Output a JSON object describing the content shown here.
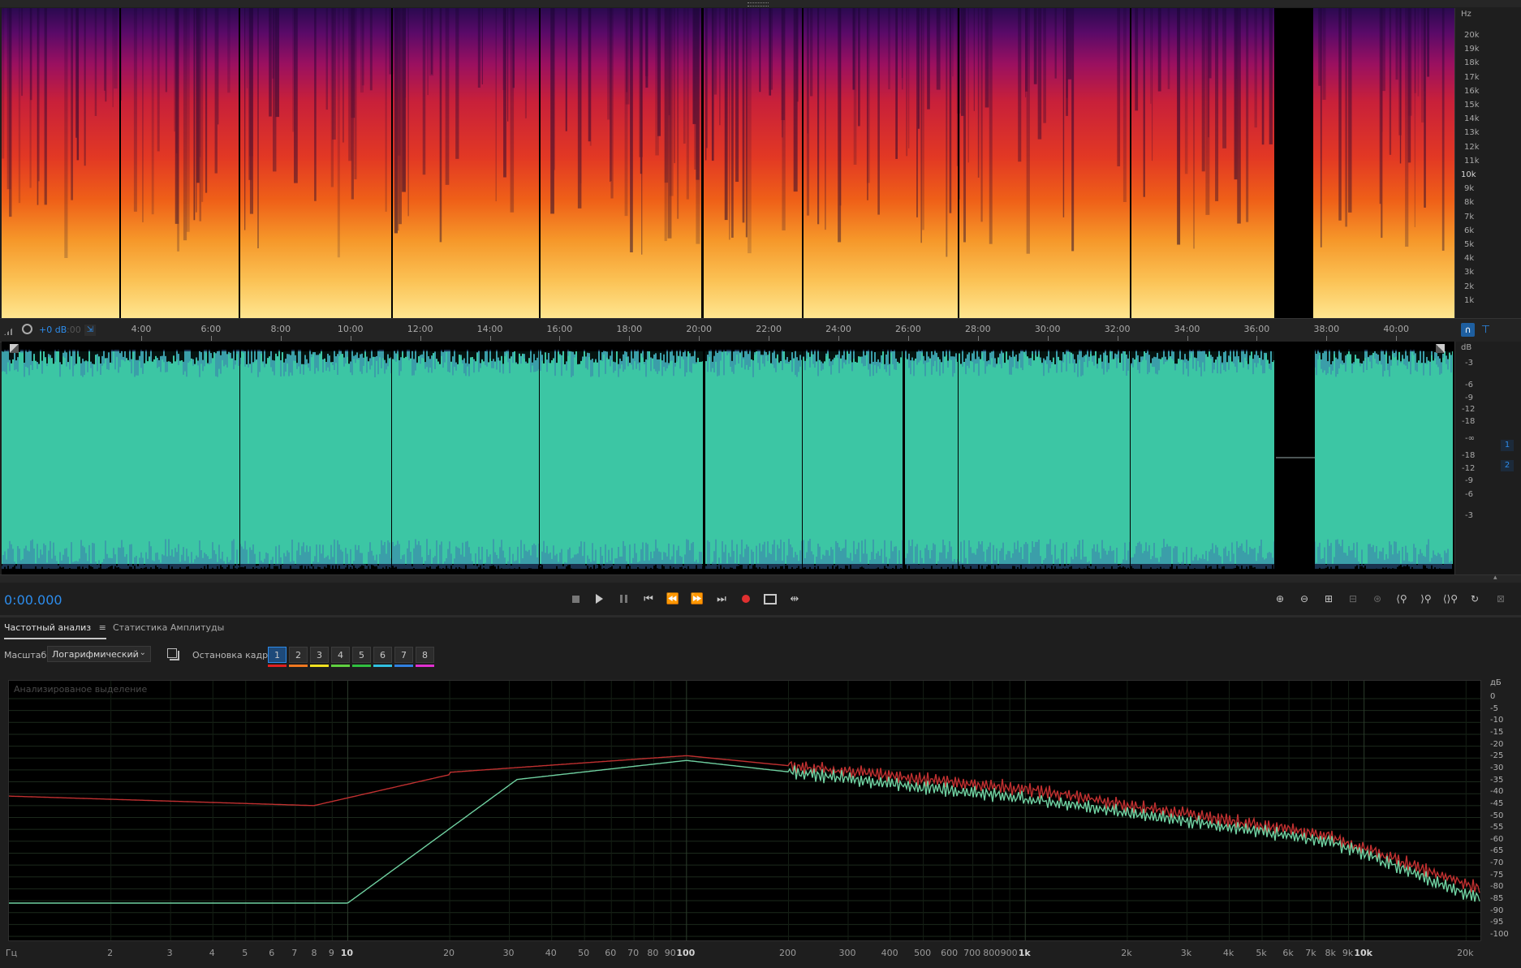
{
  "spectral_axis": {
    "unit": "Hz",
    "labels": [
      "20k",
      "19k",
      "18k",
      "17k",
      "16k",
      "15k",
      "14k",
      "13k",
      "12k",
      "11k",
      "10k",
      "9k",
      "8k",
      "7k",
      "6k",
      "5k",
      "4k",
      "3k",
      "2k",
      "1k"
    ]
  },
  "timeline": {
    "ticks": [
      "4:00",
      "6:00",
      "8:00",
      "10:00",
      "12:00",
      "14:00",
      "16:00",
      "18:00",
      "20:00",
      "22:00",
      "24:00",
      "26:00",
      "28:00",
      "30:00",
      "32:00",
      "34:00",
      "36:00",
      "38:00",
      "40:00"
    ],
    "gain_label": "+0 dB",
    "ghost_label": ":00"
  },
  "amplitude_axis": {
    "unit": "dB",
    "labels": [
      "-3",
      "-6",
      "-9",
      "-12",
      "-18",
      "-∞",
      "-18",
      "-12",
      "-9",
      "-6",
      "-3"
    ],
    "channels": [
      "1",
      "2"
    ]
  },
  "transport": {
    "time": "0:00.000",
    "icons": [
      "stop-icon",
      "play-icon",
      "pause-icon",
      "skip-to-start-icon",
      "rewind-icon",
      "fast-forward-icon",
      "skip-to-end-icon",
      "record-icon",
      "loop-icon",
      "skip-selection-icon"
    ],
    "zoom_icons": [
      "zoom-in-amplitude-icon",
      "zoom-out-amplitude-icon",
      "zoom-in-time-icon",
      "zoom-out-time-icon",
      "zoom-selection-icon",
      "zoom-in-left-icon",
      "zoom-in-right-icon",
      "zoom-out-full-icon",
      "zoom-reset-icon",
      "zoom-extra-icon"
    ]
  },
  "panel": {
    "tabs": [
      "Частотный анализ",
      "Статистика Амплитуды"
    ],
    "menu_icon": "≡",
    "scale_label": "Масштаб:",
    "scale_value": "Логарифмический",
    "freeze_label": "Остановка кадра:",
    "freeze_buttons": [
      "1",
      "2",
      "3",
      "4",
      "5",
      "6",
      "7",
      "8"
    ],
    "freeze_colors": [
      "#e02020",
      "#f07820",
      "#f0e020",
      "#60d040",
      "#30c040",
      "#30c0e0",
      "#3080e0",
      "#e030d0"
    ],
    "analysis_label": "Анализированое выделение"
  },
  "freq_axis": {
    "unit": "Гц",
    "labels": [
      "2",
      "3",
      "4",
      "5",
      "6",
      "7",
      "8",
      "9",
      "10",
      "20",
      "30",
      "40",
      "50",
      "60",
      "70",
      "80",
      "90",
      "100",
      "200",
      "300",
      "400",
      "500",
      "600",
      "700",
      "800",
      "900",
      "1k",
      "2k",
      "3k",
      "4k",
      "5k",
      "6k",
      "7k",
      "8k",
      "9k",
      "10k",
      "20k"
    ],
    "bold": [
      "10",
      "100",
      "1k",
      "10k"
    ]
  },
  "db_axis": {
    "unit": "дБ",
    "labels": [
      "0",
      "-5",
      "-10",
      "-15",
      "-20",
      "-25",
      "-30",
      "-35",
      "-40",
      "-45",
      "-50",
      "-55",
      "-60",
      "-65",
      "-70",
      "-75",
      "-80",
      "-85",
      "-90",
      "-95",
      "-100"
    ]
  },
  "colors": {
    "accent": "#2d8ceb",
    "waveform": "#3cc6a4",
    "channel1_curve": "#c03030",
    "channel2_curve": "#6fd0a0",
    "record": "#e03030"
  }
}
